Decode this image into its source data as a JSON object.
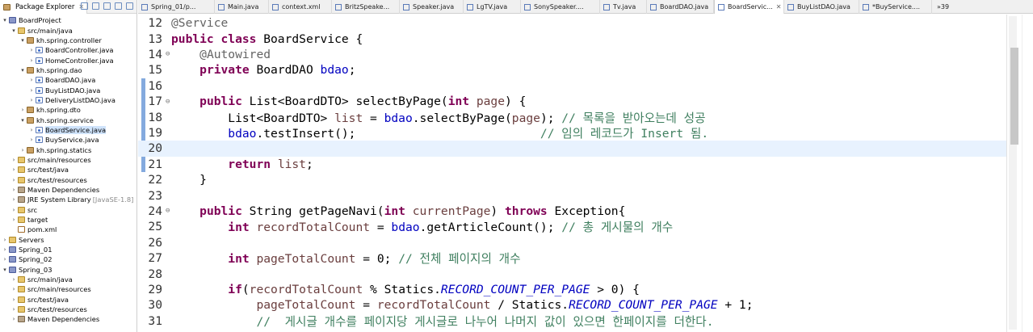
{
  "explorer": {
    "title": "Package Explorer",
    "close": "✕",
    "tree": [
      {
        "label": "BoardProject",
        "icon": "project-icon",
        "indent": 0,
        "twisty": "▾"
      },
      {
        "label": "src/main/java",
        "icon": "folder-icon",
        "indent": 1,
        "twisty": "▾"
      },
      {
        "label": "kh.spring.controller",
        "icon": "package-icon",
        "indent": 2,
        "twisty": "▾"
      },
      {
        "label": "BoardController.java",
        "icon": "java-file-icon",
        "indent": 3,
        "twisty": "›"
      },
      {
        "label": "HomeController.java",
        "icon": "java-file-icon",
        "indent": 3,
        "twisty": "›"
      },
      {
        "label": "kh.spring.dao",
        "icon": "package-icon",
        "indent": 2,
        "twisty": "▾"
      },
      {
        "label": "BoardDAO.java",
        "icon": "java-file-icon",
        "indent": 3,
        "twisty": "›"
      },
      {
        "label": "BuyListDAO.java",
        "icon": "java-file-icon",
        "indent": 3,
        "twisty": "›"
      },
      {
        "label": "DeliveryListDAO.java",
        "icon": "java-file-icon",
        "indent": 3,
        "twisty": "›"
      },
      {
        "label": "kh.spring.dto",
        "icon": "package-icon",
        "indent": 2,
        "twisty": "›"
      },
      {
        "label": "kh.spring.service",
        "icon": "package-icon",
        "indent": 2,
        "twisty": "▾"
      },
      {
        "label": "BoardService.java",
        "icon": "java-file-icon",
        "indent": 3,
        "twisty": "›",
        "selected": true
      },
      {
        "label": "BuyService.java",
        "icon": "java-file-icon",
        "indent": 3,
        "twisty": "›"
      },
      {
        "label": "kh.spring.statics",
        "icon": "package-icon",
        "indent": 2,
        "twisty": "›"
      },
      {
        "label": "src/main/resources",
        "icon": "folder-icon",
        "indent": 1,
        "twisty": "›"
      },
      {
        "label": "src/test/java",
        "icon": "folder-icon",
        "indent": 1,
        "twisty": "›"
      },
      {
        "label": "src/test/resources",
        "icon": "folder-icon",
        "indent": 1,
        "twisty": "›"
      },
      {
        "label": "Maven Dependencies",
        "icon": "library-icon",
        "indent": 1,
        "twisty": "›"
      },
      {
        "label": "JRE System Library",
        "suffix": "[JavaSE-1.8]",
        "icon": "library-icon",
        "indent": 1,
        "twisty": "›"
      },
      {
        "label": "src",
        "icon": "folder-icon",
        "indent": 1,
        "twisty": "›"
      },
      {
        "label": "target",
        "icon": "folder-icon",
        "indent": 1,
        "twisty": "›"
      },
      {
        "label": "pom.xml",
        "icon": "xml-file-icon",
        "indent": 1,
        "twisty": ""
      },
      {
        "label": "Servers",
        "icon": "folder-icon",
        "indent": 0,
        "twisty": "›"
      },
      {
        "label": "Spring_01",
        "icon": "project-icon",
        "indent": 0,
        "twisty": "›"
      },
      {
        "label": "Spring_02",
        "icon": "project-icon",
        "indent": 0,
        "twisty": "›"
      },
      {
        "label": "Spring_03",
        "icon": "project-icon",
        "indent": 0,
        "twisty": "▾"
      },
      {
        "label": "src/main/java",
        "icon": "folder-icon",
        "indent": 1,
        "twisty": "›"
      },
      {
        "label": "src/main/resources",
        "icon": "folder-icon",
        "indent": 1,
        "twisty": "›"
      },
      {
        "label": "src/test/java",
        "icon": "folder-icon",
        "indent": 1,
        "twisty": "›"
      },
      {
        "label": "src/test/resources",
        "icon": "folder-icon",
        "indent": 1,
        "twisty": "›"
      },
      {
        "label": "Maven Dependencies",
        "icon": "library-icon",
        "indent": 1,
        "twisty": "›"
      }
    ]
  },
  "tabs": [
    {
      "label": "Spring_01/p...",
      "active": false
    },
    {
      "label": "Main.java",
      "active": false
    },
    {
      "label": "context.xml",
      "active": false
    },
    {
      "label": "BritzSpeake...",
      "active": false
    },
    {
      "label": "Speaker.java",
      "active": false
    },
    {
      "label": "LgTV.java",
      "active": false
    },
    {
      "label": "SonySpeaker....",
      "active": false
    },
    {
      "label": "Tv.java",
      "active": false
    },
    {
      "label": "BoardDAO.java",
      "active": false
    },
    {
      "label": "BoardServic...",
      "active": true,
      "close": "✕"
    },
    {
      "label": "BuyListDAO.java",
      "active": false
    },
    {
      "label": "*BuyService....",
      "active": false
    }
  ],
  "tab_overflow": "»39",
  "code": {
    "current_line": 20,
    "lines": [
      {
        "n": "12",
        "fold": "",
        "tokens": [
          [
            "ann",
            "@Service"
          ]
        ]
      },
      {
        "n": "13",
        "fold": "",
        "tokens": [
          [
            "kw",
            "public"
          ],
          [
            "",
            " "
          ],
          [
            "kw",
            "class"
          ],
          [
            "",
            " BoardService {"
          ]
        ]
      },
      {
        "n": "14",
        "fold": "⊖",
        "tokens": [
          [
            "",
            "    "
          ],
          [
            "ann",
            "@Autowired"
          ]
        ]
      },
      {
        "n": "15",
        "fold": "",
        "tokens": [
          [
            "",
            "    "
          ],
          [
            "kw",
            "private"
          ],
          [
            "",
            " BoardDAO "
          ],
          [
            "fld",
            "bdao"
          ],
          [
            "",
            ";"
          ]
        ]
      },
      {
        "n": "16",
        "fold": "",
        "tokens": []
      },
      {
        "n": "17",
        "fold": "⊖",
        "tokens": [
          [
            "",
            "    "
          ],
          [
            "kw",
            "public"
          ],
          [
            "",
            " List<BoardDTO> selectByPage("
          ],
          [
            "kw",
            "int"
          ],
          [
            "",
            " "
          ],
          [
            "param",
            "page"
          ],
          [
            "",
            ") {"
          ]
        ]
      },
      {
        "n": "18",
        "fold": "",
        "tokens": [
          [
            "",
            "        List<BoardDTO> "
          ],
          [
            "local",
            "list"
          ],
          [
            "",
            " = "
          ],
          [
            "fld",
            "bdao"
          ],
          [
            "",
            ".selectByPage("
          ],
          [
            "param",
            "page"
          ],
          [
            "",
            "); "
          ],
          [
            "cmt",
            "// 목록을 받아오는데 성공"
          ]
        ]
      },
      {
        "n": "19",
        "fold": "",
        "tokens": [
          [
            "",
            "        "
          ],
          [
            "fld",
            "bdao"
          ],
          [
            "",
            ".testInsert();                          "
          ],
          [
            "cmt",
            "// 임의 레코드가 Insert 됨."
          ]
        ]
      },
      {
        "n": "20",
        "fold": "",
        "tokens": []
      },
      {
        "n": "21",
        "fold": "",
        "tokens": [
          [
            "",
            "        "
          ],
          [
            "kw",
            "return"
          ],
          [
            "",
            " "
          ],
          [
            "local",
            "list"
          ],
          [
            "",
            ";"
          ]
        ]
      },
      {
        "n": "22",
        "fold": "",
        "tokens": [
          [
            "",
            "    }"
          ]
        ]
      },
      {
        "n": "23",
        "fold": "",
        "tokens": []
      },
      {
        "n": "24",
        "fold": "⊖",
        "tokens": [
          [
            "",
            "    "
          ],
          [
            "kw",
            "public"
          ],
          [
            "",
            " String getPageNavi("
          ],
          [
            "kw",
            "int"
          ],
          [
            "",
            " "
          ],
          [
            "param",
            "currentPage"
          ],
          [
            "",
            ") "
          ],
          [
            "kw",
            "throws"
          ],
          [
            "",
            " Exception{"
          ]
        ]
      },
      {
        "n": "25",
        "fold": "",
        "tokens": [
          [
            "",
            "        "
          ],
          [
            "kw",
            "int"
          ],
          [
            "",
            " "
          ],
          [
            "local",
            "recordTotalCount"
          ],
          [
            "",
            " = "
          ],
          [
            "fld",
            "bdao"
          ],
          [
            "",
            ".getArticleCount(); "
          ],
          [
            "cmt",
            "// 총 게시물의 개수"
          ]
        ]
      },
      {
        "n": "26",
        "fold": "",
        "tokens": []
      },
      {
        "n": "27",
        "fold": "",
        "tokens": [
          [
            "",
            "        "
          ],
          [
            "kw",
            "int"
          ],
          [
            "",
            " "
          ],
          [
            "local",
            "pageTotalCount"
          ],
          [
            "",
            " = 0; "
          ],
          [
            "cmt",
            "// 전체 페이지의 개수"
          ]
        ]
      },
      {
        "n": "28",
        "fold": "",
        "tokens": []
      },
      {
        "n": "29",
        "fold": "",
        "tokens": [
          [
            "",
            "        "
          ],
          [
            "kw",
            "if"
          ],
          [
            "",
            "("
          ],
          [
            "local",
            "recordTotalCount"
          ],
          [
            "",
            " % Statics."
          ],
          [
            "const",
            "RECORD_COUNT_PER_PAGE"
          ],
          [
            "",
            " > 0) {"
          ]
        ]
      },
      {
        "n": "30",
        "fold": "",
        "tokens": [
          [
            "",
            "            "
          ],
          [
            "local",
            "pageTotalCount"
          ],
          [
            "",
            " = "
          ],
          [
            "local",
            "recordTotalCount"
          ],
          [
            "",
            " / Statics."
          ],
          [
            "const",
            "RECORD_COUNT_PER_PAGE"
          ],
          [
            "",
            " + 1;"
          ]
        ]
      },
      {
        "n": "31",
        "fold": "",
        "tokens": [
          [
            "",
            "            "
          ],
          [
            "cmt",
            "//  게시글 개수를 페이지당 게시글로 나누어 나머지 값이 있으면 한페이지를 더한다."
          ]
        ]
      }
    ]
  },
  "scroll": {
    "position_fraction": 0.1,
    "visible_fraction": 0.31
  },
  "colors": {
    "keyword": "#7f0055",
    "annotation": "#646464",
    "comment": "#3f7f5f",
    "field": "#0000c0",
    "current_line_bg": "#e8f2fe",
    "selection_bg": "#cfe3fb"
  }
}
